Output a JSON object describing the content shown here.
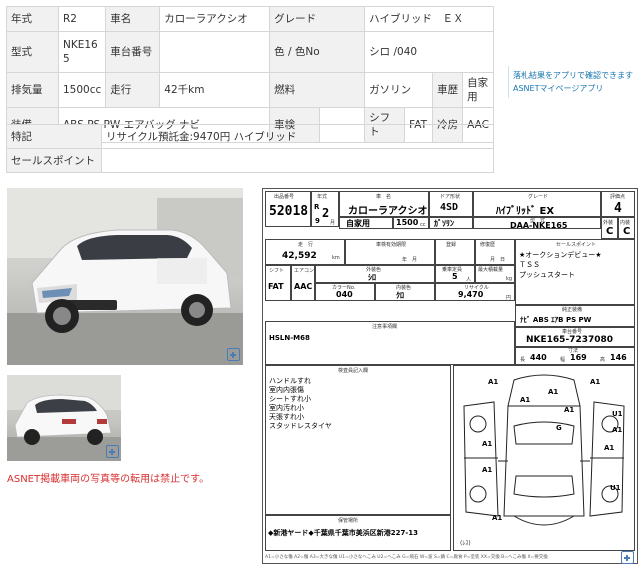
{
  "spec": {
    "row1": {
      "year_label": "年式",
      "year": "R2",
      "model_label": "車名",
      "model": "カローラアクシオ",
      "grade_label": "グレード",
      "grade": "ハイブリッド　ＥＸ"
    },
    "row2": {
      "type_label": "型式",
      "type": "NKE165",
      "chassis_label": "車台番号",
      "chassis": "",
      "color_label": "色 / 色No",
      "color": "シロ /040"
    },
    "row3": {
      "disp_label": "排気量",
      "disp": "1500cc",
      "mileage_label": "走行",
      "mileage": "42千km",
      "fuel_label": "燃料",
      "fuel": "ガソリン",
      "ship_label": "車歴",
      "ship": "自家用"
    },
    "row4": {
      "equip_label": "装備",
      "equip": "ABS PS PW エアバッグ ナビ",
      "inspection_label": "車検",
      "inspection": "",
      "shift_label": "シフト",
      "shift": "FAT",
      "ac_label": "冷房",
      "ac": "AAC"
    }
  },
  "extra": {
    "notes_label": "特記",
    "notes": "リサイクル預託金:9470円 ハイブリッド",
    "sales_label": "セールスポイント",
    "sales": ""
  },
  "promo": {
    "line1": "落札結果をアプリで確認できます",
    "line2": "ASNETマイページアプリ"
  },
  "notice": "ASNET掲載車両の写真等の転用は禁止です。",
  "sheet": {
    "h_lot": "出品番号",
    "lot": "52018",
    "h_year": "年式",
    "year_era": "R",
    "year": "2",
    "h_model": "車　名",
    "model": "カローラアクシオ",
    "h_door": "ドア形状",
    "door": "4SD",
    "h_grade": "グレード",
    "grade": "ﾊｲﾌﾞﾘｯﾄﾞ EX",
    "h_score": "評価点",
    "score": "4",
    "h_month": "月",
    "month": "9",
    "usage": "自家用",
    "disp": "1500",
    "disp_unit": "cc",
    "fuel": "ｶﾞｿﾘﾝ",
    "h_type": "型　式",
    "type": "DAA-NKE165",
    "h_ext": "外装",
    "ext": "C",
    "h_int": "内装",
    "int": "C",
    "h_mileage": "走　行",
    "mileage": "42,592",
    "mileage_unit": "km",
    "h_inspect": "車検有効期限",
    "h_repair": "修復歴",
    "h_reg": "登録",
    "reg_unit": "年　月",
    "reg_unit2": "月　日",
    "h_shift": "シフト",
    "shift": "FAT",
    "h_ac": "エアコン",
    "ac": "AAC",
    "h_color": "外装色",
    "color": "ｼﾛ",
    "h_capacity": "乗車定員",
    "capacity": "5",
    "capacity_unit": "人",
    "h_load": "最大積載量",
    "load_unit": "kg",
    "h_color_no": "カラーNo.",
    "color_no": "040",
    "h_trim": "内装色",
    "trim": "ｸﾛ",
    "h_recycle": "リサイクル",
    "recycle": "9,470",
    "recycle_unit": "円",
    "h_sales": "セールスポイント",
    "sales_points": [
      "★オークションデビュー★",
      "ＴＳＳ",
      "プッシュスタート"
    ],
    "h_equip": "純正装備",
    "equip": "ﾅﾋﾞ ABS ｴｱB PS PW",
    "h_frame": "車台番号",
    "frame": "NKE165-7237080",
    "h_notes": "注意事項欄",
    "notes": "HSLN-M68",
    "h_size": "寸法",
    "len_label": "長",
    "len": "440",
    "wid_label": "幅",
    "wid": "169",
    "hei_label": "高",
    "hei": "146",
    "h_inspector": "検査員記入欄",
    "inspector_notes": [
      "ハンドルすれ",
      "室内内張傷",
      "シートすれ小",
      "室内汚れ小",
      "天張すれ小",
      "スタッドレスタイヤ"
    ],
    "h_parking": "保管場所",
    "parking": "◆新港ヤード◆千葉県千葉市美浜区新港227-13",
    "diagram_labels": [
      "A1",
      "A1",
      "A1",
      "A1",
      "A1",
      "U1",
      "A1",
      "G",
      "A1",
      "A1",
      "A1",
      "U1",
      "A1"
    ],
    "diagram_tag": "(ﾚｽ)",
    "footer": "A1=小さな傷 A2=傷 A3=大きな傷 U1=小さなへこみ U2=へこみ G=飛石 W=波 S=錆 C=腐食 P=塗装 XX=交換 B=へこみ傷 X=要交換"
  }
}
